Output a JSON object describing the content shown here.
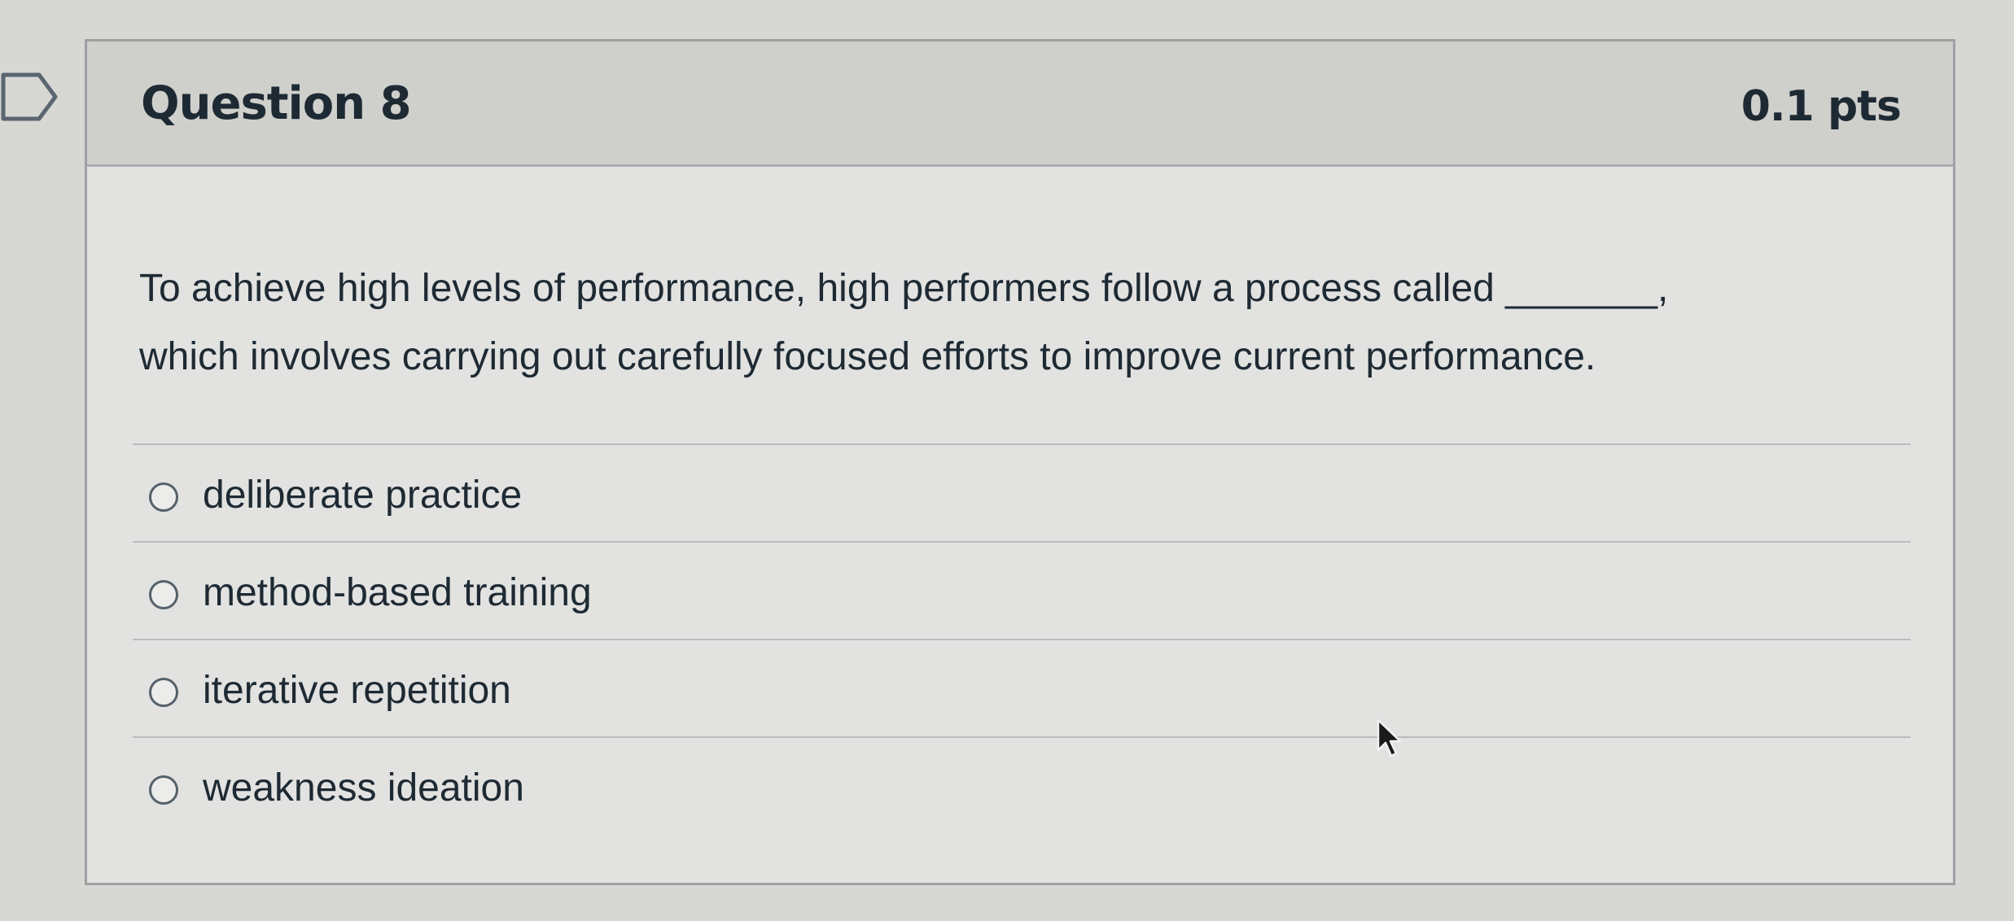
{
  "question": {
    "title": "Question 8",
    "points": "0.1 pts",
    "text_line1": "To achieve high levels of performance, high performers follow a process called _______,",
    "text_line2": "which involves carrying out carefully focused efforts to improve current performance."
  },
  "answers": [
    {
      "label": "deliberate practice",
      "selected": false
    },
    {
      "label": "method-based training",
      "selected": false
    },
    {
      "label": "iterative repetition",
      "selected": false
    },
    {
      "label": "weakness ideation",
      "selected": false
    }
  ],
  "icons": {
    "bookmark": "bookmark-outline-icon",
    "cursor": "mouse-pointer-icon"
  },
  "colors": {
    "header_bg": "#cfcfcc",
    "card_bg": "#e2e2e0",
    "page_bg": "#d7d7d4",
    "text": "#1e2a33"
  }
}
